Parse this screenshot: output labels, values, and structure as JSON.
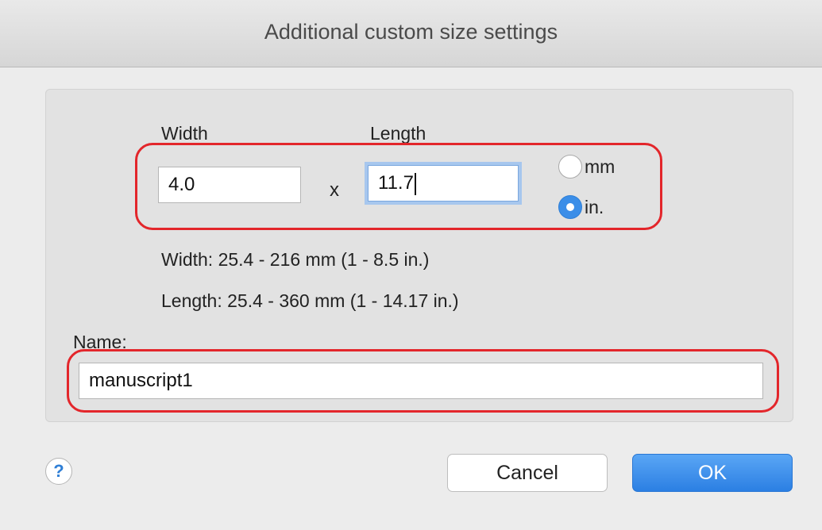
{
  "window": {
    "title": "Additional custom size settings"
  },
  "size": {
    "width_label": "Width",
    "length_label": "Length",
    "width_value": "4.0",
    "length_value": "11.7",
    "times_symbol": "x",
    "units": [
      {
        "label": "mm",
        "selected": false
      },
      {
        "label": "in.",
        "selected": true
      }
    ],
    "width_range": "Width: 25.4 - 216 mm (1 - 8.5 in.)",
    "length_range": "Length: 25.4 - 360 mm (1 - 14.17 in.)"
  },
  "name": {
    "label": "Name:",
    "value": "manuscript1"
  },
  "buttons": {
    "help": "?",
    "cancel": "Cancel",
    "ok": "OK"
  },
  "colors": {
    "highlight": "#e3262b",
    "accent": "#2b7fe3",
    "focus_ring": "#a7c7ee"
  },
  "icons": {
    "help": "help-icon",
    "radio_on": "radio-selected-icon",
    "radio_off": "radio-unselected-icon"
  }
}
